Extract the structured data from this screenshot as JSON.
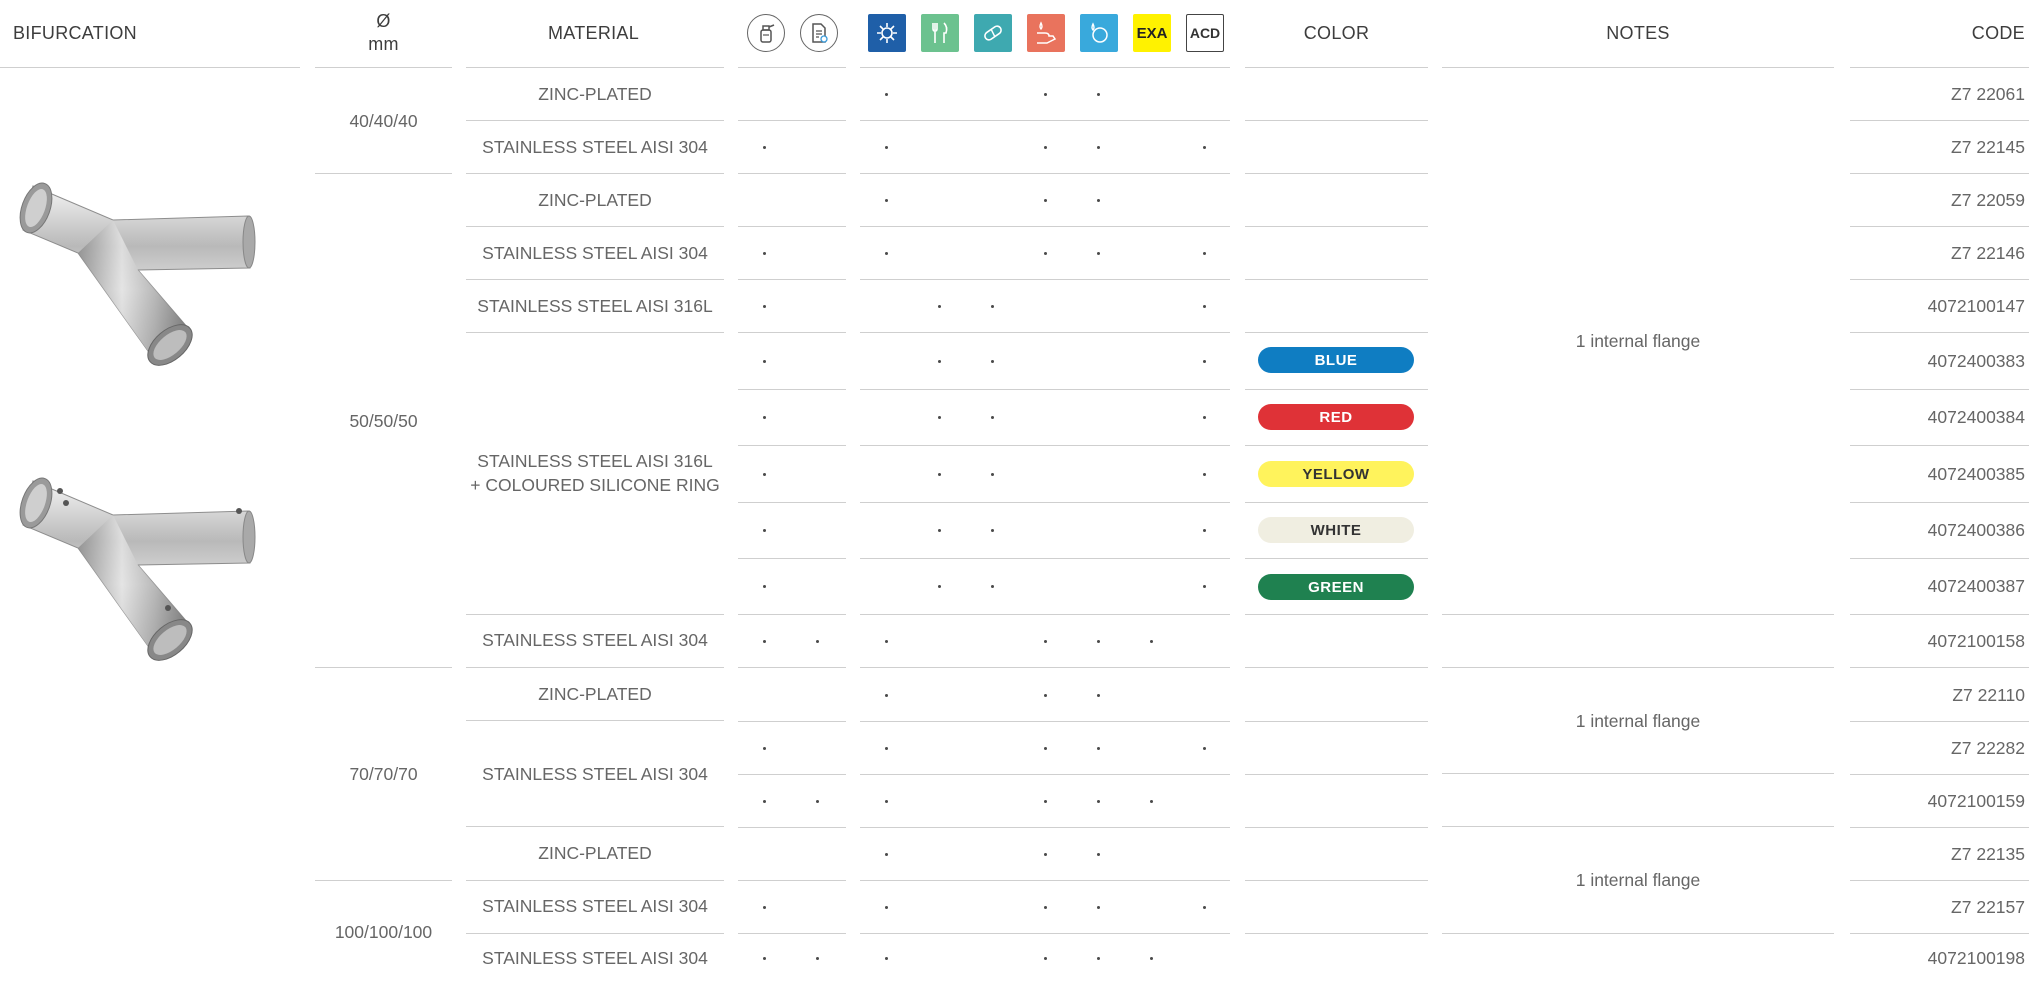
{
  "headers": {
    "bifurcation": "BIFURCATION",
    "diameter_symbol": "Ø",
    "diameter_unit": "mm",
    "material": "MATERIAL",
    "color": "COLOR",
    "notes": "NOTES",
    "code": "CODE"
  },
  "icons": {
    "col1": {
      "name": "spray-bottle-icon"
    },
    "col2": {
      "name": "document-certificate-icon"
    },
    "col3": {
      "name": "gear-icon",
      "bg": "#1f5fa8"
    },
    "col4": {
      "name": "fork-knife-icon",
      "bg": "#6cc28f"
    },
    "col5": {
      "name": "pill-icon",
      "bg": "#3ea9b0"
    },
    "col6": {
      "name": "hand-drop-icon",
      "bg": "#e9735d"
    },
    "col7": {
      "name": "drop-cycle-icon",
      "bg": "#39a9dc"
    },
    "col8": {
      "label": "EXA",
      "bg": "#fff200"
    },
    "col9": {
      "label": "ACD"
    }
  },
  "diameters": [
    "40/40/40",
    "50/50/50",
    "70/70/70",
    "100/100/100"
  ],
  "materials": [
    "ZINC-PLATED",
    "STAINLESS STEEL AISI 304",
    "ZINC-PLATED",
    "STAINLESS STEEL AISI 304",
    "STAINLESS STEEL AISI 316L",
    "STAINLESS STEEL AISI 316L",
    "+ COLOURED SILICONE RING",
    "STAINLESS STEEL AISI 304",
    "ZINC-PLATED",
    "STAINLESS STEEL AISI 304",
    "ZINC-PLATED",
    "STAINLESS STEEL AISI 304",
    "STAINLESS STEEL AISI 304"
  ],
  "colors": [
    {
      "label": "BLUE",
      "bg": "#0f7dc2",
      "fg": "#ffffff"
    },
    {
      "label": "RED",
      "bg": "#df3237",
      "fg": "#ffffff"
    },
    {
      "label": "YELLOW",
      "bg": "#fff35c",
      "fg": "#333333"
    },
    {
      "label": "WHITE",
      "bg": "#f0eee1",
      "fg": "#333333"
    },
    {
      "label": "GREEN",
      "bg": "#1f8150",
      "fg": "#ffffff"
    }
  ],
  "notes": [
    "1 internal flange",
    "1 internal flange",
    "1 internal flange"
  ],
  "codes": [
    "Z7 22061",
    "Z7 22145",
    "Z7 22059",
    "Z7 22146",
    "4072100147",
    "4072400383",
    "4072400384",
    "4072400385",
    "4072400386",
    "4072400387",
    "4072100158",
    "Z7 22110",
    "Z7 22282",
    "4072100159",
    "Z7 22135",
    "Z7 22157",
    "4072100198"
  ],
  "dot_matrix": [
    [
      0,
      0,
      1,
      0,
      0,
      1,
      1,
      0,
      0
    ],
    [
      1,
      0,
      1,
      0,
      0,
      1,
      1,
      0,
      1
    ],
    [
      0,
      0,
      1,
      0,
      0,
      1,
      1,
      0,
      0
    ],
    [
      1,
      0,
      1,
      0,
      0,
      1,
      1,
      0,
      1
    ],
    [
      1,
      0,
      0,
      1,
      1,
      0,
      0,
      0,
      1
    ],
    [
      1,
      0,
      0,
      1,
      1,
      0,
      0,
      0,
      1
    ],
    [
      1,
      0,
      0,
      1,
      1,
      0,
      0,
      0,
      1
    ],
    [
      1,
      0,
      0,
      1,
      1,
      0,
      0,
      0,
      1
    ],
    [
      1,
      0,
      0,
      1,
      1,
      0,
      0,
      0,
      1
    ],
    [
      1,
      0,
      0,
      1,
      1,
      0,
      0,
      0,
      1
    ],
    [
      1,
      1,
      1,
      0,
      0,
      1,
      1,
      1,
      0
    ],
    [
      0,
      0,
      1,
      0,
      0,
      1,
      1,
      0,
      0
    ],
    [
      1,
      0,
      1,
      0,
      0,
      1,
      1,
      0,
      1
    ],
    [
      1,
      1,
      1,
      0,
      0,
      1,
      1,
      1,
      0
    ],
    [
      0,
      0,
      1,
      0,
      0,
      1,
      1,
      0,
      0
    ],
    [
      1,
      0,
      1,
      0,
      0,
      1,
      1,
      0,
      1
    ],
    [
      1,
      1,
      1,
      0,
      0,
      1,
      1,
      1,
      0
    ]
  ]
}
